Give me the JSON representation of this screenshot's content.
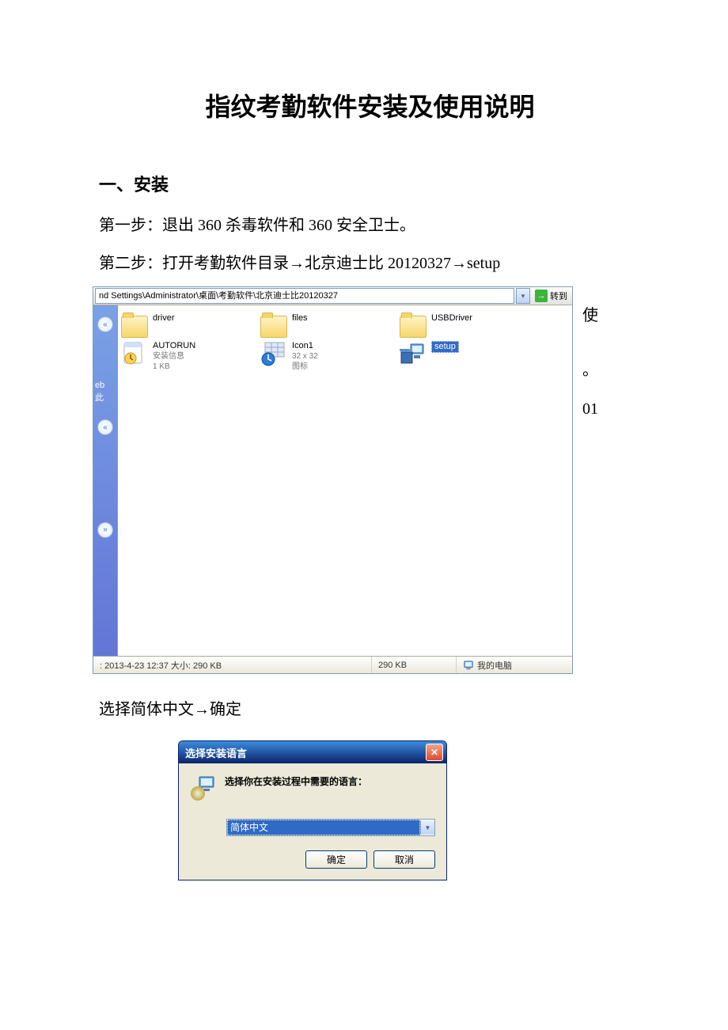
{
  "doc_title": "指纹考勤软件安装及使用说明",
  "section1_heading": "一、安装",
  "step1": "第一步：退出 360 杀毒软件和 360 安全卫士。",
  "step2": "第二步：打开考勤软件目录→北京迪士比 20120327→setup",
  "step3": "选择简体中文→确定",
  "explorer": {
    "address_path": "nd Settings\\Administrator\\桌面\\考勤软件\\北京迪士比20120327",
    "go_label": "转到",
    "side_frag1": "eb",
    "side_frag2": "此",
    "items": [
      {
        "name": "driver",
        "sub1": "",
        "sub2": "",
        "kind": "folder"
      },
      {
        "name": "files",
        "sub1": "",
        "sub2": "",
        "kind": "folder"
      },
      {
        "name": "USBDriver",
        "sub1": "",
        "sub2": "",
        "kind": "folder"
      },
      {
        "name": "AUTORUN",
        "sub1": "安装信息",
        "sub2": "1 KB",
        "kind": "inf"
      },
      {
        "name": "Icon1",
        "sub1": "32 x 32",
        "sub2": "图标",
        "kind": "ico"
      },
      {
        "name": "setup",
        "sub1": "",
        "sub2": "",
        "kind": "exe"
      }
    ],
    "status_left": ": 2013-4-23 12:37 大小: 290 KB",
    "status_size": "290 KB",
    "status_location": "我的电脑"
  },
  "right_edge": {
    "l1": "使",
    "l2": "。",
    "l3": "01"
  },
  "dialog": {
    "title": "选择安装语言",
    "message": "选择你在安装过程中需要的语言：",
    "selected": "简体中文",
    "ok": "确定",
    "cancel": "取消"
  }
}
